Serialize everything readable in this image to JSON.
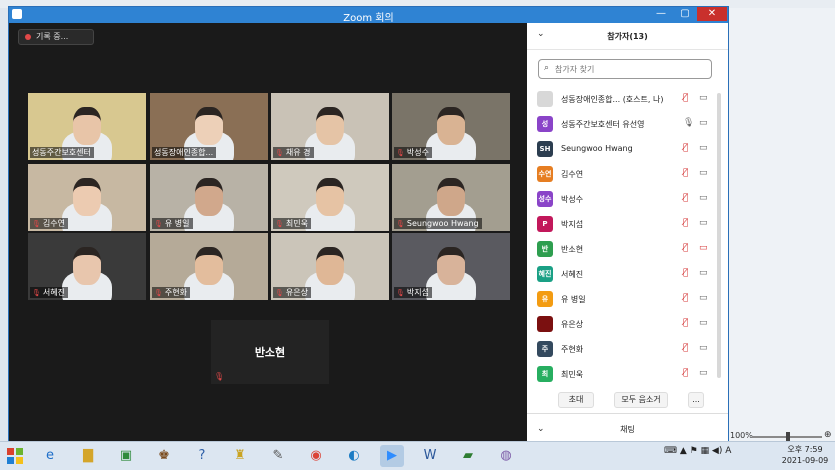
{
  "window": {
    "title": "Zoom 회의",
    "min": "—",
    "max": "▢",
    "close": "✕"
  },
  "recording": {
    "label": "기록 중..."
  },
  "tiles": [
    {
      "name": "성동주간보호센터",
      "muted": false,
      "active": true
    },
    {
      "name": "성동장애인종합...",
      "muted": false
    },
    {
      "name": "채유 경",
      "muted": true
    },
    {
      "name": "박성수",
      "muted": true
    },
    {
      "name": "김수연",
      "muted": true
    },
    {
      "name": "유 병일",
      "muted": true
    },
    {
      "name": "최민욱",
      "muted": true
    },
    {
      "name": "Seungwoo Hwang",
      "muted": true
    },
    {
      "name": "서혜진",
      "muted": true
    },
    {
      "name": "주현화",
      "muted": true
    },
    {
      "name": "유은상",
      "muted": true
    },
    {
      "name": "박지섭",
      "muted": true
    }
  ],
  "name_only_tile": {
    "name": "반소현"
  },
  "panel": {
    "title": "참가자(13)",
    "search_placeholder": "참가자 찾기",
    "participants": [
      {
        "avatar": "",
        "color": "#d8d8d8",
        "name": "성동장애인종합... (호스트, 나)",
        "mic": "muted-red",
        "cam": "on"
      },
      {
        "avatar": "성",
        "color": "#8a44c8",
        "name": "성동주간보호센터 유선영",
        "mic": "on",
        "cam": "on"
      },
      {
        "avatar": "SH",
        "color": "#2c3e50",
        "name": "Seungwoo Hwang",
        "mic": "muted",
        "cam": "on"
      },
      {
        "avatar": "수연",
        "color": "#e67e22",
        "name": "김수연",
        "mic": "muted",
        "cam": "on"
      },
      {
        "avatar": "성수",
        "color": "#8a44c8",
        "name": "박성수",
        "mic": "muted",
        "cam": "on"
      },
      {
        "avatar": "P",
        "color": "#c2185b",
        "name": "박지섭",
        "mic": "muted",
        "cam": "on"
      },
      {
        "avatar": "반",
        "color": "#2e9e4f",
        "name": "반소현",
        "mic": "muted",
        "cam": "off"
      },
      {
        "avatar": "혜진",
        "color": "#1aa085",
        "name": "서혜진",
        "mic": "muted",
        "cam": "on"
      },
      {
        "avatar": "유",
        "color": "#f39c12",
        "name": "유 병일",
        "mic": "muted",
        "cam": "on"
      },
      {
        "avatar": "",
        "color": "#7b1010",
        "name": "유은상",
        "mic": "muted",
        "cam": "on"
      },
      {
        "avatar": "주",
        "color": "#34495e",
        "name": "주현화",
        "mic": "muted",
        "cam": "on"
      },
      {
        "avatar": "최",
        "color": "#27ae60",
        "name": "최민욱",
        "mic": "muted",
        "cam": "on"
      }
    ],
    "buttons": {
      "invite": "초대",
      "mute_all": "모두 음소거",
      "more": "..."
    },
    "chat_label": "채팅"
  },
  "taskbar": {
    "zoom_level": "100%",
    "time": "오후 7:59",
    "date": "2021-09-09"
  }
}
